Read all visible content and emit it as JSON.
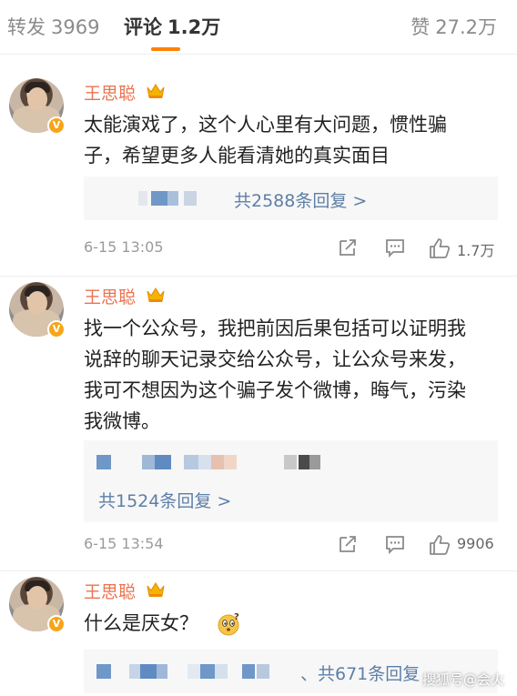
{
  "tabs": {
    "repost": {
      "label": "转发",
      "count": "3969"
    },
    "comments": {
      "label": "评论",
      "count": "1.2万"
    },
    "likes": {
      "label": "赞",
      "count": "27.2万"
    }
  },
  "accent_color": "#ff8200",
  "name_color": "#eb7350",
  "link_color": "#5d7fa6",
  "comments": [
    {
      "author": "王思聪",
      "lines": [
        "太能演戏了，这个人心里有大问题，惯性骗",
        "子，希望更多人能看清她的真实面目"
      ],
      "replies_label": "共2588条回复 >",
      "time": "6-15 13:05",
      "likes": "1.7万"
    },
    {
      "author": "王思聪",
      "lines": [
        "找一个公众号，我把前因后果包括可以证明我",
        "说辞的聊天记录交给公众号，让公众号来发，",
        "我可不想因为这个骗子发个微博，晦气，污染",
        "我微博。"
      ],
      "replies_label": "共1524条回复 >",
      "time": "6-15 13:54",
      "likes": "9906"
    },
    {
      "author": "王思聪",
      "lines": [
        "什么是厌女？"
      ],
      "replies_label": "、共671条回复",
      "emoji": "thinking-face-icon"
    }
  ],
  "watermark": "搜狐号@会火"
}
